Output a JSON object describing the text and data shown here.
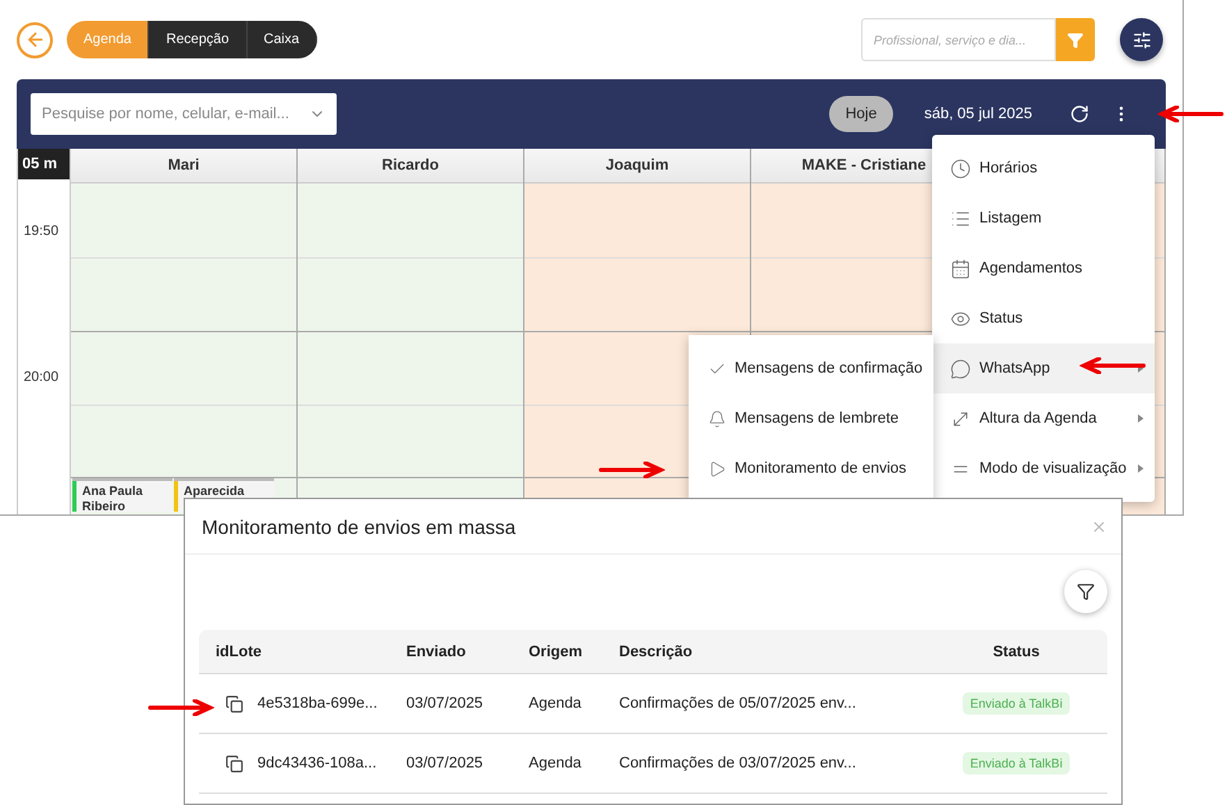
{
  "topbar": {
    "tabs": [
      {
        "label": "Agenda",
        "selected": true
      },
      {
        "label": "Recepção",
        "selected": false
      },
      {
        "label": "Caixa",
        "selected": false
      }
    ],
    "search": {
      "placeholder": "Profissional, serviço e dia..."
    }
  },
  "calendar_header": {
    "search": {
      "placeholder": "Pesquise por nome, celular, e-mail..."
    },
    "today_button": "Hoje",
    "date": "sáb, 05 jul 2025"
  },
  "calendar": {
    "interval": "05 m",
    "columns": [
      {
        "name": "Mari",
        "color": "#eef6ec"
      },
      {
        "name": "Ricardo",
        "color": "#eef6ec"
      },
      {
        "name": "Joaquim",
        "color": "#fde9d9"
      },
      {
        "name": "MAKE - Cristiane",
        "color": "#fde9d9"
      },
      {
        "color": "#fde9d9"
      }
    ],
    "times": [
      "19:50",
      "20:00"
    ],
    "appointments": [
      {
        "name": "Ana Paula Ribeiro",
        "color": "#2ecc55"
      },
      {
        "name": "Aparecida",
        "color": "#f2c313"
      }
    ]
  },
  "menu": {
    "items": [
      {
        "label": "Horários",
        "selected": false,
        "submenu": false
      },
      {
        "label": "Listagem",
        "selected": false,
        "submenu": false
      },
      {
        "label": "Agendamentos",
        "selected": false,
        "submenu": false
      },
      {
        "label": "Status",
        "selected": false,
        "submenu": false
      },
      {
        "label": "WhatsApp",
        "selected": true,
        "submenu": true
      },
      {
        "label": "Altura da Agenda",
        "selected": false,
        "submenu": true
      },
      {
        "label": "Modo de visualização",
        "selected": false,
        "submenu": true
      }
    ]
  },
  "submenu": {
    "items": [
      "Mensagens de confirmação",
      "Mensagens de lembrete",
      "Monitoramento de envios"
    ]
  },
  "dialog": {
    "title": "Monitoramento de envios em massa",
    "columns": [
      "idLote",
      "Enviado",
      "Origem",
      "Descrição",
      "Status"
    ],
    "rows": [
      {
        "id": "4e5318ba-699e...",
        "sent": "03/07/2025",
        "origin": "Agenda",
        "description": "Confirmações de 05/07/2025 env...",
        "status": "Enviado à TalkBi"
      },
      {
        "id": "9dc43436-108a...",
        "sent": "03/07/2025",
        "origin": "Agenda",
        "description": "Confirmações de 03/07/2025 env...",
        "status": "Enviado à TalkBi"
      }
    ]
  }
}
